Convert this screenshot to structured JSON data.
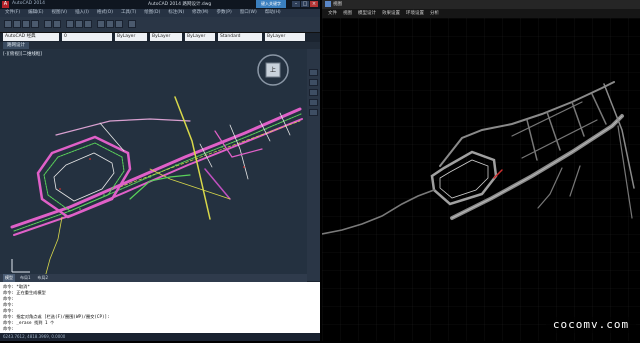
{
  "cad": {
    "title": "AutoCAD 2014",
    "center_title": "AutoCAD 2014   路网设计.dwg",
    "search_label": "键入关键字",
    "menu": [
      "文件(F)",
      "编辑(E)",
      "视图(V)",
      "插入(I)",
      "格式(O)",
      "工具(T)",
      "绘图(D)",
      "标注(N)",
      "修改(M)",
      "参数(P)",
      "窗口(W)",
      "帮助(H)"
    ],
    "workspace": "AutoCAD 经典",
    "combo_layer": "0",
    "combo_color": "ByLayer",
    "combo_linetype": "ByLayer",
    "combo_lineweight": "ByLayer",
    "combo_style": "Standard",
    "doc_tab": "路网设计",
    "viewport_label": "[-][俯视][二维线框]",
    "viewcube_label": "上",
    "model_tabs": [
      "模型",
      "布局1",
      "布局2"
    ],
    "command_lines": [
      "命令: *取消*",
      "命令: 正在重生成模型",
      "命令:",
      "命令:",
      "命令:",
      "命令: 指定对角点或 [栏选(F)/圈围(WP)/圈交(CP)]:",
      "命令: _erase 找到 1 个",
      "命令:"
    ],
    "status_text": "6243.7612, 4818.3969, 0.0000"
  },
  "viewer": {
    "title": "视图",
    "menu": [
      "文件",
      "视图",
      "模型设计",
      "效果设置",
      "环境设置",
      "分析"
    ]
  },
  "watermark": "cocomv.com",
  "colors": {
    "road_magenta": "#e060c8",
    "road_green": "#5ad25a",
    "road_yellow": "#d8d84a",
    "road_white": "#e6e6e6",
    "road_gray": "#8a8a8a",
    "accent_red": "#d03030"
  }
}
